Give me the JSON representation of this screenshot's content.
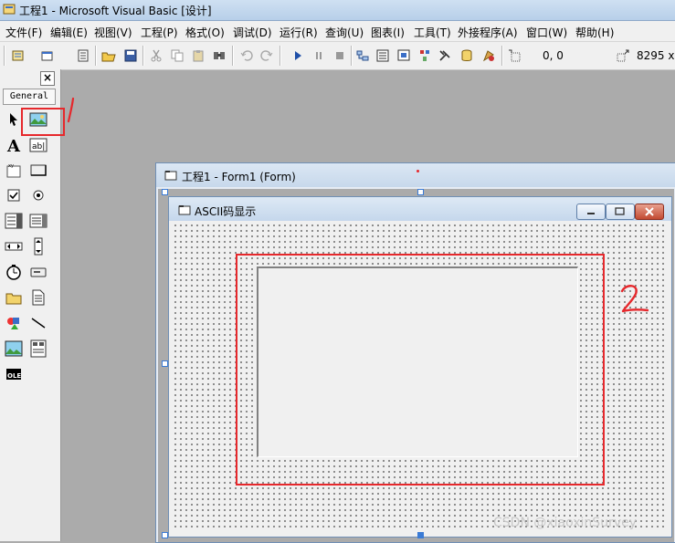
{
  "window": {
    "title": "工程1 - Microsoft Visual Basic [设计]"
  },
  "menubar": {
    "items": [
      "文件(F)",
      "编辑(E)",
      "视图(V)",
      "工程(P)",
      "格式(O)",
      "调试(D)",
      "运行(R)",
      "查询(U)",
      "图表(I)",
      "工具(T)",
      "外接程序(A)",
      "窗口(W)",
      "帮助(H)"
    ]
  },
  "toolbar": {
    "position": "0, 0",
    "size": "8295 x"
  },
  "toolbox": {
    "close_label": "×",
    "tab_label": "General"
  },
  "designer": {
    "title": "工程1 - Form1 (Form)"
  },
  "form": {
    "caption": "ASCII码显示"
  },
  "annotations": {
    "label_1": "1",
    "label_2": "2",
    "color": "#e6282c"
  },
  "watermark": {
    "text": "CSDN @xiaoxinSurvey"
  }
}
